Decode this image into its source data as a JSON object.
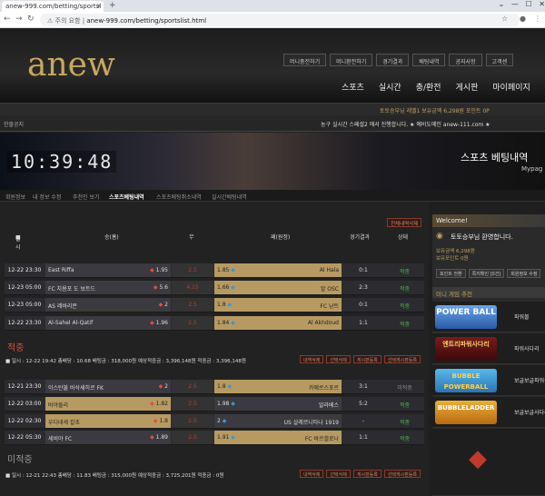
{
  "browser": {
    "tab_title": "anew-999.com/betting/sportsl",
    "address_warning": "주의 요함",
    "url": "anew-999.com/betting/sportslist.html"
  },
  "site": {
    "logo": "anew",
    "top_buttons": [
      "머니충전하기",
      "머니환전하기",
      "경기결과",
      "배팅내역",
      "공지사항",
      "고객센"
    ],
    "main_nav": [
      "스포츠",
      "실시간",
      "충/환전",
      "게시판",
      "마이페이지"
    ]
  },
  "userbar": "토토승부님  레벨1  보유금액 6,298원  포인트 0P",
  "notice": {
    "label": "한줄공지",
    "text": "농구 실시간 스페셜2 에서 진행합니다. ★ 예비도메인 anew-111.com ★"
  },
  "banner": {
    "clock": "10:39:48",
    "title": "스포츠 베팅내역",
    "subtitle": "Mypag"
  },
  "subnav": [
    "회원정보",
    "내 정보 수정",
    "추천인 보기",
    "스포츠베팅내역",
    "스포츠베팅취소내역",
    "실시간베팅내역"
  ],
  "betlist_button": "전체내역삭제",
  "table_header": {
    "date": "일시",
    "home": "승(홈)",
    "draw": "무",
    "away": "패(원정)",
    "score": "경기결과",
    "status": "상태"
  },
  "bets": [
    {
      "title": "적중",
      "info": "일시 : 12-22 19:42   총배당 : 10.68   배팅금 : 318,000원   예상적중금 : 3,396,148원   적중금 : 3,396,148원",
      "rows": [
        {
          "date": "12-22 23:30",
          "home": "East Riffa",
          "home_odd": "1.95",
          "draw": "2.5",
          "away": "Al Hala",
          "away_odd": "1.85",
          "score": "0:1",
          "status": "적중"
        },
        {
          "date": "12-23 05:00",
          "home": "FC 치용포 도 보트드",
          "home_odd": "5.6",
          "draw": "4.15",
          "away": "알 OSC",
          "away_odd": "1.66",
          "score": "2:3",
          "status": "적중"
        },
        {
          "date": "12-23 05:00",
          "home": "AS 레바리몬",
          "home_odd": "2",
          "draw": "2.5",
          "away": "FC 낭트",
          "away_odd": "1.8",
          "score": "0:1",
          "status": "적중"
        },
        {
          "date": "12-22 23:30",
          "home": "Al-Sahel Al-Qatif",
          "home_odd": "1.96",
          "draw": "2.5",
          "away": "Al Akhdoud",
          "away_odd": "1.84",
          "score": "1:1",
          "status": "적중"
        }
      ]
    },
    {
      "title": "미적중",
      "info": "일시 : 12-21 22:43   총배당 : 11.83   배팅금 : 315,000원   예상적중금 : 3,725,201원   적중금 : 0원",
      "rows": [
        {
          "date": "12-21 23:30",
          "home": "이스탄불 바삭셰히르 FK",
          "home_odd": "2",
          "draw": "2.5",
          "away": "카예르스포르",
          "away_odd": "1.8",
          "score": "3:1",
          "status": "미적중"
        },
        {
          "date": "12-22 03:00",
          "home": "바야돌리",
          "home_odd": "1.82",
          "draw": "2.5",
          "away": "알라베스",
          "away_odd": "1.98",
          "score": "5:2",
          "status": "적중"
        },
        {
          "date": "12-22 02:30",
          "home": "우디네세 칼초",
          "home_odd": "1.8",
          "draw": "2.5",
          "away": "US 살레르니타나 1919",
          "away_odd": "2",
          "score": "-",
          "status": "적중"
        },
        {
          "date": "12-22 05:30",
          "home": "세비야 FC",
          "home_odd": "1.89",
          "draw": "2.5",
          "away": "FC 바르셀로나",
          "away_odd": "1.91",
          "score": "1:1",
          "status": "적중"
        }
      ]
    }
  ],
  "bet_buttons": [
    "내역삭제",
    "선택삭제",
    "게시판등록",
    "선택게시판등록"
  ],
  "sidebar": {
    "welcome": "Welcome!",
    "name": "토토승부님 환영합니다.",
    "balance": "보유금액 6,298원",
    "points": "보유포인트 0원",
    "buttons": [
      "포인트 전환",
      "쪽지확인 [0건]",
      "회원정보 수정"
    ],
    "mini_title": "미니 게임 추천"
  },
  "games": [
    {
      "logo": "POWER BALL",
      "name": "파워볼"
    },
    {
      "logo": "엔트리파워사다리",
      "name": "파워사다리"
    },
    {
      "logo": "BUBBLE POWERBALL",
      "name": "보글보글파워볼"
    },
    {
      "logo": "BUBBLELADDER",
      "name": "보글보글사다리"
    }
  ],
  "colors": {
    "gold": "#b79a62",
    "win": "#4caf50",
    "up": "#e74c3c",
    "down": "#3498db"
  }
}
